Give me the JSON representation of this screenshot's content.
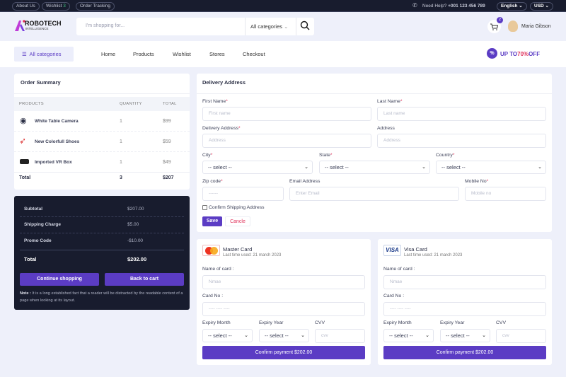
{
  "topbar": {
    "links": [
      "About Us",
      "Wishlist",
      "Order Tracking"
    ],
    "wishlist_count": "3",
    "help_label": "Need Help?",
    "phone": "+001 123 456 789",
    "language": "English",
    "currency": "USD"
  },
  "header": {
    "logo_main": "ROBOTECH",
    "logo_sub": "INTELLIGENCE",
    "search_placeholder": "I'm shopping for...",
    "category_select": "All categories",
    "cart_count": "2",
    "user_name": "Maria Gibson"
  },
  "nav": {
    "all_categories": "All categories",
    "items": [
      "Home",
      "Products",
      "Wishlist",
      "Stores",
      "Checkout"
    ],
    "promo_prefix": "UP TO",
    "promo_percent": "70%",
    "promo_suffix": "OFF"
  },
  "order_summary": {
    "title": "Order Summary",
    "columns": [
      "PRODUCTS",
      "QUANTITY",
      "TOTAL"
    ],
    "rows": [
      {
        "name": "White Table Camera",
        "qty": "1",
        "total": "$99"
      },
      {
        "name": "New Colorfull Shoes",
        "qty": "1",
        "total": "$59"
      },
      {
        "name": "Imported VR Box",
        "qty": "1",
        "total": "$49"
      }
    ],
    "total_label": "Total",
    "total_qty": "3",
    "total_amount": "$207"
  },
  "totals": {
    "subtotal_label": "Subtotal",
    "subtotal": "$207.00",
    "shipping_label": "Shipping Charge",
    "shipping": "$5.00",
    "promo_label": "Promo Code",
    "promo": "-$10.00",
    "total_label": "Total",
    "total": "$202.00",
    "continue_btn": "Continue shopping",
    "back_btn": "Back to cart",
    "note_label": "Note :",
    "note": "It is a long established fact that a reader will be distracted by the readable content of a page when looking at its layout."
  },
  "delivery": {
    "title": "Delivery Address",
    "first_name_label": "First Name",
    "first_name_ph": "First name",
    "last_name_label": "Last Name",
    "last_name_ph": "Last name",
    "delivery_address_label": "Delivery Address",
    "address_ph": "Address",
    "address_label": "Address",
    "city_label": "City",
    "state_label": "State",
    "country_label": "Country",
    "select_ph": "-- select --",
    "zip_label": "Zip code",
    "zip_ph": "------",
    "email_label": "Email Address",
    "email_ph": "Enter Email",
    "mobile_label": "Mobile No",
    "mobile_ph": "Mobile no",
    "confirm_label": "Confirm Shipping Address",
    "save": "Save",
    "cancel": "Cancle"
  },
  "cards": [
    {
      "name": "Master Card",
      "last_used": "Last time used: 21 march 2023",
      "logo": "MasterCard",
      "name_label": "Name of card :",
      "name_ph": "Nmae",
      "no_label": "Card No :",
      "no_ph": "---- ---- ----",
      "month_label": "Expiry Month",
      "year_label": "Expiry Year",
      "cvv_label": "CVV",
      "cvv_ph": "cvv",
      "select_ph": "-- select --",
      "confirm": "Confirm payment $202.00"
    },
    {
      "name": "Visa Card",
      "last_used": "Last time used: 21 march 2023",
      "logo": "VISA",
      "name_label": "Name of card :",
      "name_ph": "Nmae",
      "no_label": "Card No :",
      "no_ph": "---- ---- ----",
      "month_label": "Expiry Month",
      "year_label": "Expiry Year",
      "cvv_label": "CVV",
      "cvv_ph": "cvv",
      "select_ph": "-- select --",
      "confirm": "Confirm payment $202.00"
    }
  ],
  "colors": {
    "accent": "#5b3cc4",
    "dark": "#181c2e",
    "bg": "#eef0fa",
    "promo": "#e0315a"
  }
}
